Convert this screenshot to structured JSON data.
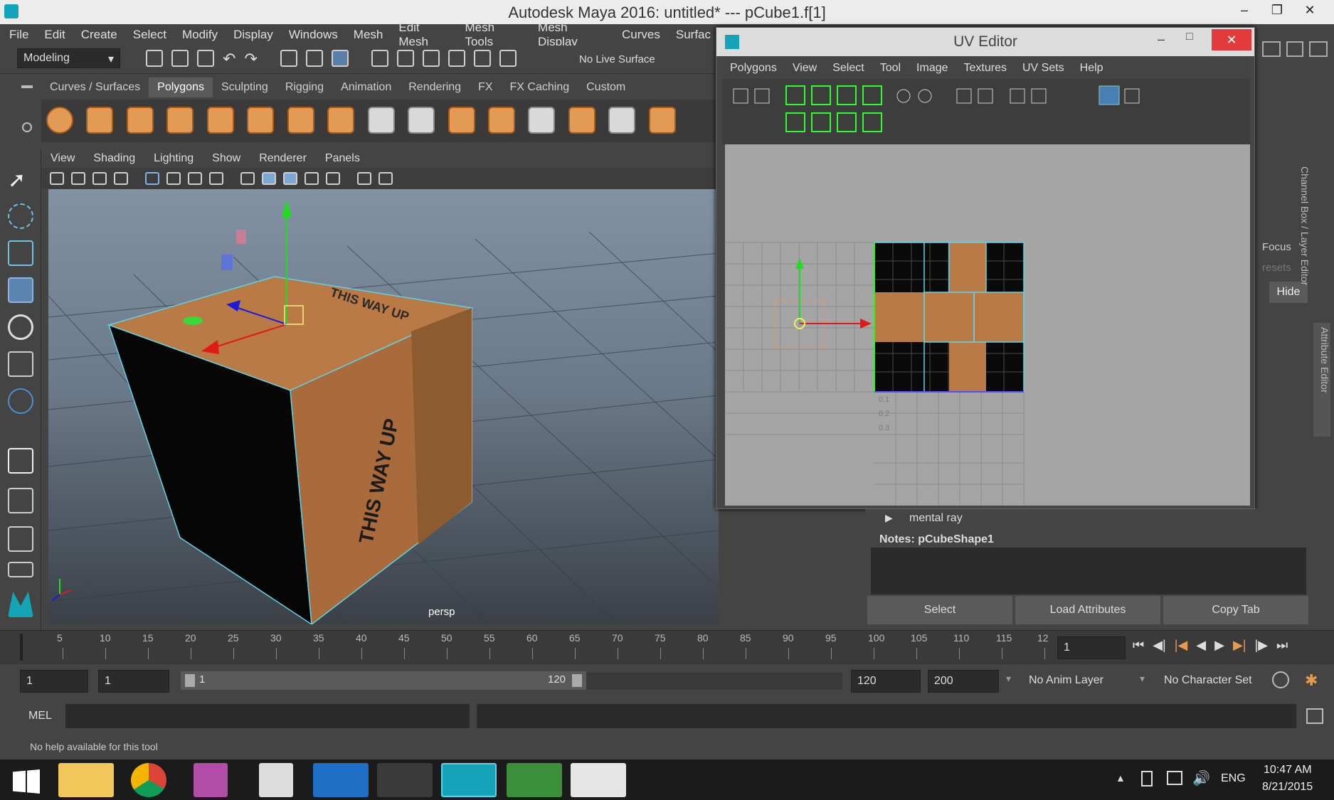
{
  "window": {
    "title": "Autodesk Maya 2016: untitled*   ---   pCube1.f[1]"
  },
  "menubar": [
    "File",
    "Edit",
    "Create",
    "Select",
    "Modify",
    "Display",
    "Windows",
    "Mesh",
    "Edit Mesh",
    "Mesh Tools",
    "Mesh Display",
    "Curves",
    "Surfac"
  ],
  "toolbar": {
    "mode": "Modeling",
    "live_surface": "No Live Surface"
  },
  "shelf": {
    "tabs": [
      "Curves / Surfaces",
      "Polygons",
      "Sculpting",
      "Rigging",
      "Animation",
      "Rendering",
      "FX",
      "FX Caching",
      "Custom"
    ],
    "active_tab": "Polygons"
  },
  "viewport": {
    "menu": [
      "View",
      "Shading",
      "Lighting",
      "Show",
      "Renderer",
      "Panels"
    ],
    "camera": "persp",
    "box_text": "THIS WAY UP"
  },
  "uv_editor": {
    "title": "UV Editor",
    "menu": [
      "Polygons",
      "View",
      "Select",
      "Tool",
      "Image",
      "Textures",
      "UV Sets",
      "Help"
    ],
    "axis_labels": [
      "0.1",
      "0.2",
      "0.3"
    ]
  },
  "right_panel": {
    "focus": "Focus",
    "presets": "resets",
    "hide": "Hide",
    "side_tabs": [
      "Channel Box / Layer Editor",
      "Attribute Editor"
    ]
  },
  "attribute_editor": {
    "section": "mental ray",
    "notes": "Notes:  pCubeShape1",
    "buttons": [
      "Select",
      "Load Attributes",
      "Copy Tab"
    ]
  },
  "timeline": {
    "ticks": [
      "5",
      "10",
      "15",
      "20",
      "25",
      "30",
      "35",
      "40",
      "45",
      "50",
      "55",
      "60",
      "65",
      "70",
      "75",
      "80",
      "85",
      "90",
      "95",
      "100",
      "105",
      "110",
      "115",
      "12"
    ],
    "current_frame": "1"
  },
  "range": {
    "start": "1",
    "playback_start": "1",
    "slider_start": "1",
    "slider_end": "120",
    "end": "120",
    "anim_end": "200",
    "anim_layer": "No Anim Layer",
    "char_set": "No Character Set"
  },
  "command_line": {
    "label": "MEL"
  },
  "help_line": "No help available for this tool",
  "taskbar": {
    "lang": "ENG",
    "time": "10:47 AM",
    "date": "8/21/2015"
  },
  "colors": {
    "accent_orange": "#e39a55",
    "selection_cyan": "#5fd3e6",
    "uv_green": "#19ff19"
  }
}
